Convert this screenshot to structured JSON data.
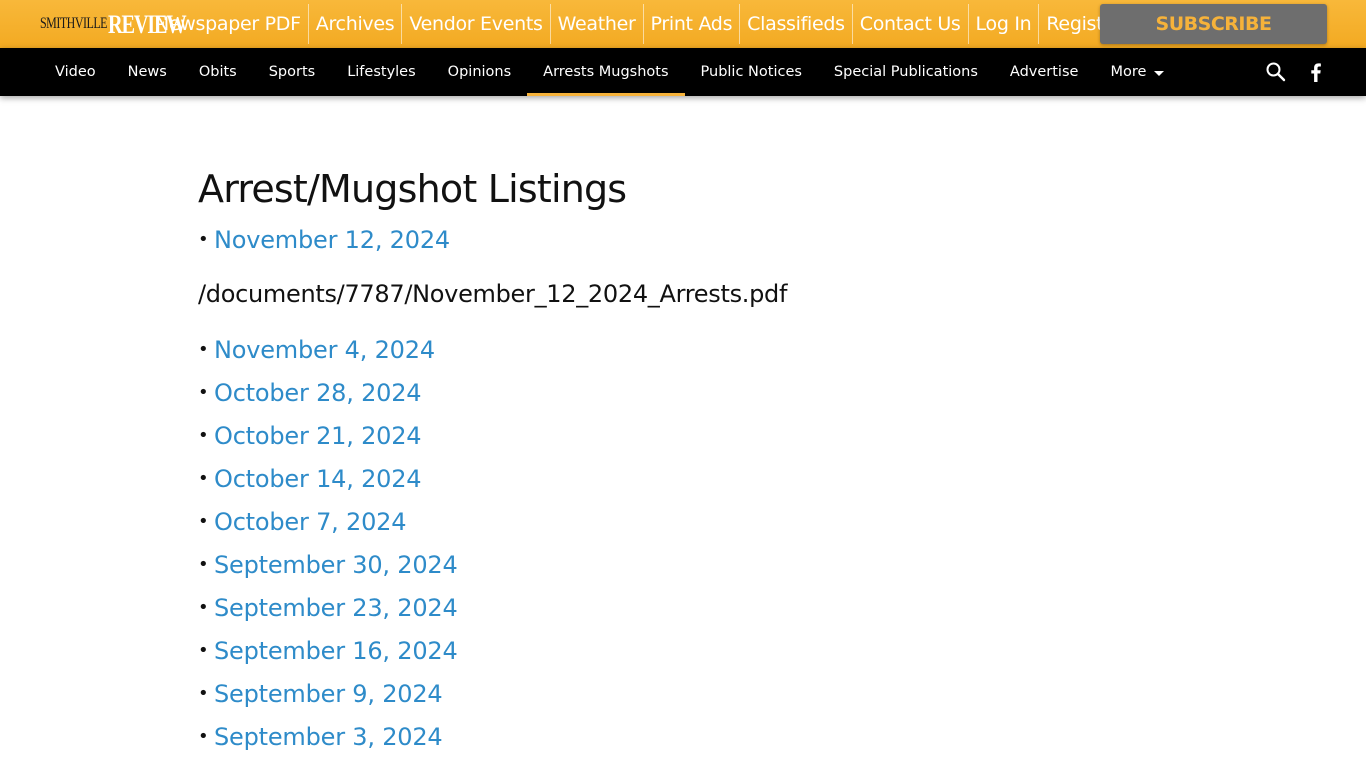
{
  "site": {
    "logo_small": "SMITHVILLE",
    "logo_big": "REVIEW"
  },
  "topbar": {
    "links": [
      "Newspaper PDF",
      "Archives",
      "Vendor Events",
      "Weather",
      "Print Ads",
      "Classifieds",
      "Contact Us",
      "Log In",
      "Register"
    ],
    "subscribe_label": "SUBSCRIBE"
  },
  "nav": {
    "items": [
      "Video",
      "News",
      "Obits",
      "Sports",
      "Lifestyles",
      "Opinions",
      "Arrests Mugshots",
      "Public Notices",
      "Special Publications",
      "Advertise",
      "More"
    ],
    "active": "Arrests Mugshots",
    "icons": [
      "search-icon",
      "facebook-icon"
    ]
  },
  "main": {
    "title": "Arrest/Mugshot Listings",
    "bullet": "•",
    "first_listing": "November 12, 2024",
    "document_path": "/documents/7787/November_12_2024_Arrests.pdf",
    "listings": [
      "November 4, 2024",
      "October 28, 2024",
      "October 21, 2024",
      "October 14, 2024",
      "October 7, 2024",
      "September 30, 2024",
      "September 23, 2024",
      "September 16, 2024",
      "September 9, 2024",
      "September 3, 2024"
    ]
  },
  "colors": {
    "topbar": "#f6b23a",
    "navbar": "#000000",
    "link": "#2e8bc9",
    "subscribe_bg": "#6e6e6e",
    "accent": "#f6b23a"
  }
}
